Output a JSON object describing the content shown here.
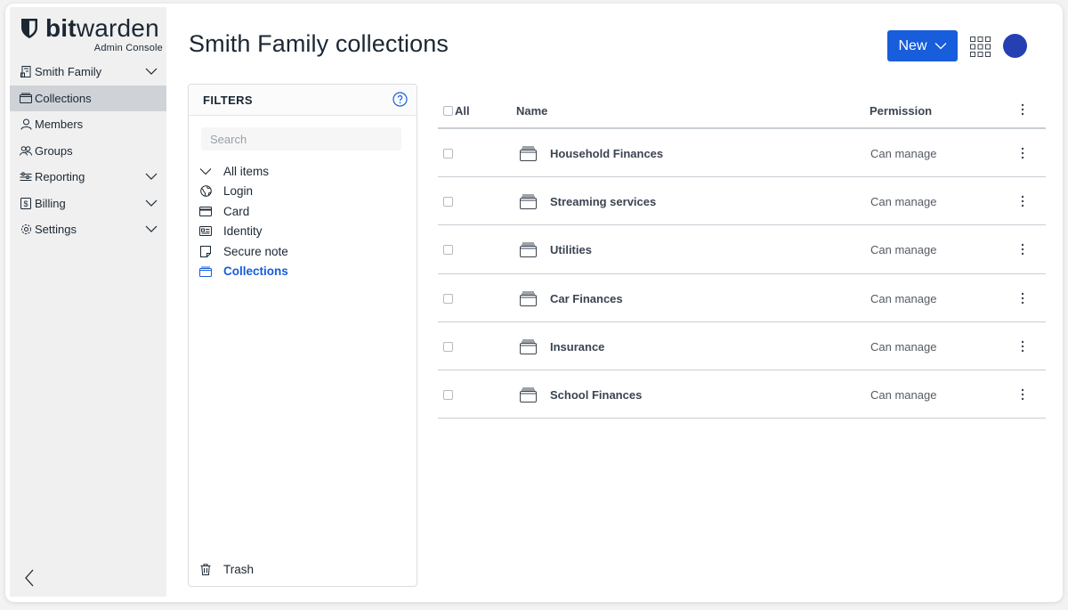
{
  "brand": {
    "wordmark_bold": "bit",
    "wordmark_light": "warden",
    "subtitle": "Admin Console"
  },
  "sidebar": {
    "items": [
      {
        "label": "Smith Family",
        "icon": "organization-icon",
        "has_chevron": true,
        "active": false
      },
      {
        "label": "Collections",
        "icon": "collections-icon",
        "has_chevron": false,
        "active": true
      },
      {
        "label": "Members",
        "icon": "user-icon",
        "has_chevron": false,
        "active": false
      },
      {
        "label": "Groups",
        "icon": "users-icon",
        "has_chevron": false,
        "active": false
      },
      {
        "label": "Reporting",
        "icon": "sliders-icon",
        "has_chevron": true,
        "active": false
      },
      {
        "label": "Billing",
        "icon": "billing-icon",
        "has_chevron": true,
        "active": false
      },
      {
        "label": "Settings",
        "icon": "gear-icon",
        "has_chevron": true,
        "active": false
      }
    ]
  },
  "header": {
    "title": "Smith Family collections",
    "new_label": "New"
  },
  "filters": {
    "title": "FILTERS",
    "search_placeholder": "Search",
    "items": [
      {
        "label": "All items",
        "icon": "chevron-down-icon",
        "active": false
      },
      {
        "label": "Login",
        "icon": "globe-icon",
        "active": false
      },
      {
        "label": "Card",
        "icon": "credit-card-icon",
        "active": false
      },
      {
        "label": "Identity",
        "icon": "id-card-icon",
        "active": false
      },
      {
        "label": "Secure note",
        "icon": "note-icon",
        "active": false
      },
      {
        "label": "Collections",
        "icon": "collections-icon",
        "active": true
      }
    ],
    "trash_label": "Trash"
  },
  "table": {
    "headers": {
      "all": "All",
      "name": "Name",
      "permission": "Permission"
    },
    "rows": [
      {
        "name": "Household Finances",
        "permission": "Can manage"
      },
      {
        "name": "Streaming services",
        "permission": "Can manage"
      },
      {
        "name": "Utilities",
        "permission": "Can manage"
      },
      {
        "name": "Car Finances",
        "permission": "Can manage"
      },
      {
        "name": "Insurance",
        "permission": "Can manage"
      },
      {
        "name": "School Finances",
        "permission": "Can manage"
      }
    ]
  },
  "colors": {
    "primary": "#175ddc",
    "sidebar_bg": "#f0f0f0",
    "active_bg": "#cfd3d8",
    "avatar": "#2440b3"
  }
}
